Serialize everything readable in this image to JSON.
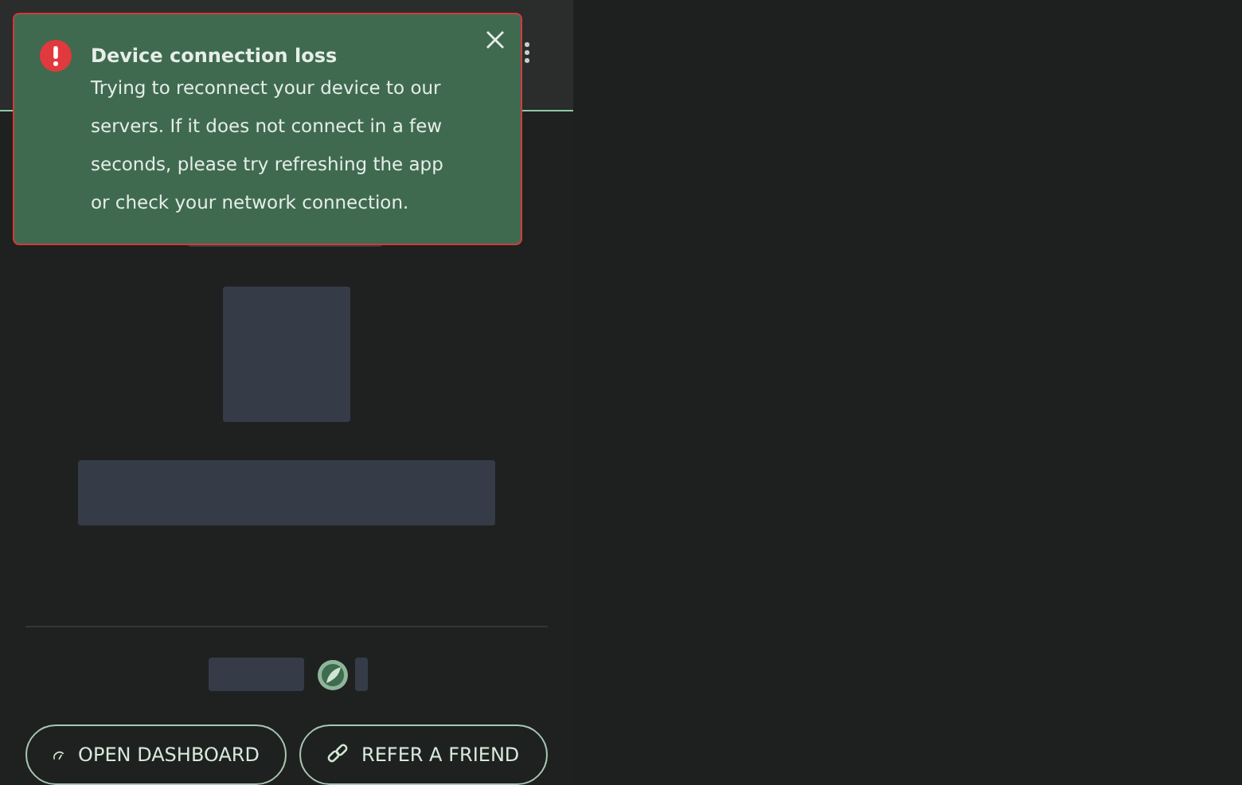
{
  "toast": {
    "title": "Device connection loss",
    "message": "Trying to reconnect your device to our servers. If it does not connect in a few seconds, please try refreshing the app or check your network connection."
  },
  "buttons": [
    {
      "label": "OPEN DASHBOARD",
      "kind": "dashboard"
    },
    {
      "label": "REFER A FRIEND",
      "kind": "link"
    }
  ]
}
